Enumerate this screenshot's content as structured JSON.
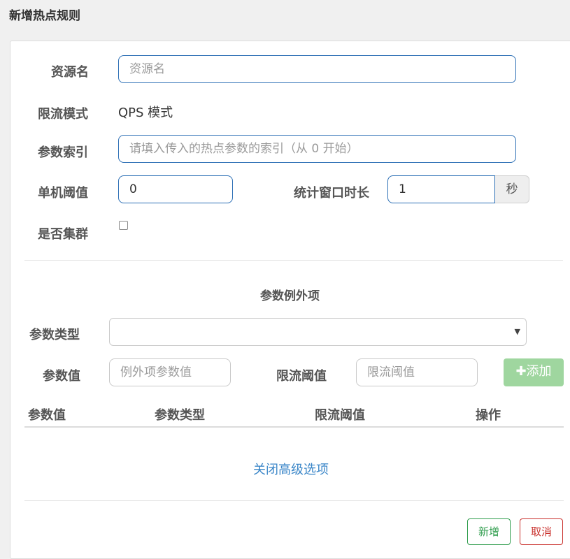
{
  "page_title": "新增热点规则",
  "form": {
    "resource_label": "资源名",
    "resource_placeholder": "资源名",
    "mode_label": "限流模式",
    "mode_value": "QPS 模式",
    "param_index_label": "参数索引",
    "param_index_placeholder": "请填入传入的热点参数的索引（从 0 开始）",
    "threshold_label": "单机阈值",
    "threshold_value": "0",
    "window_label": "统计窗口时长",
    "window_value": "1",
    "window_unit": "秒",
    "cluster_label": "是否集群"
  },
  "exceptions": {
    "section_title": "参数例外项",
    "param_type_label": "参数类型",
    "param_type_value": "",
    "param_value_label": "参数值",
    "param_value_placeholder": "例外项参数值",
    "limit_label": "限流阈值",
    "limit_placeholder": "限流阈值",
    "add_button": "添加",
    "table_headers": [
      "参数值",
      "参数类型",
      "限流阈值",
      "操作"
    ]
  },
  "advanced_link": "关闭高级选项",
  "footer": {
    "submit_label": "新增",
    "cancel_label": "取消"
  },
  "colors": {
    "primary_border": "#2c6fb5",
    "add_button_bg": "#9fd69f",
    "submit": "#2e9c4c",
    "cancel": "#c9302c",
    "link": "#3a86c8"
  }
}
